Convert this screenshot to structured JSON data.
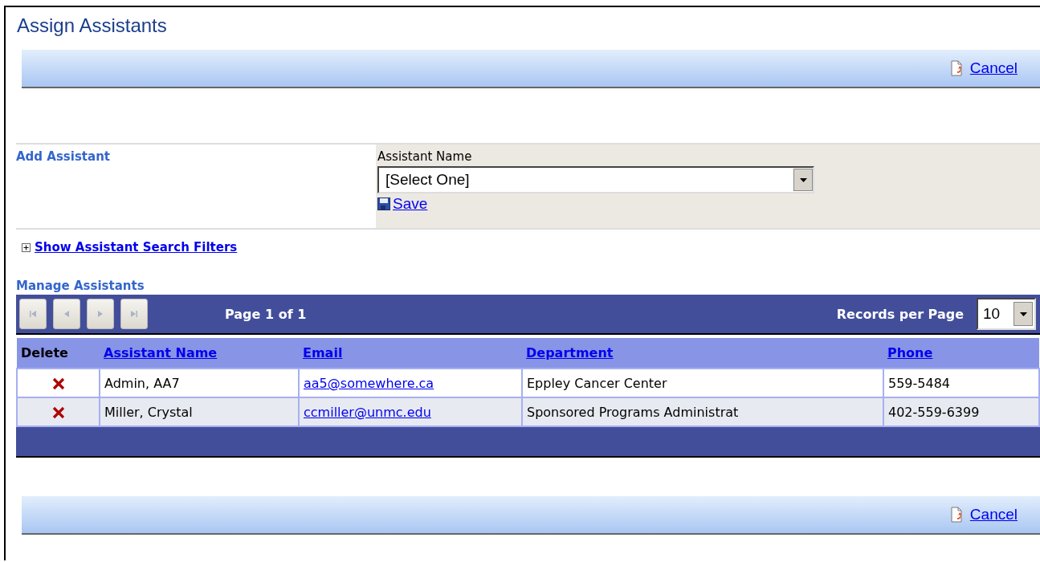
{
  "page_title": "Assign Assistants",
  "top_toolbar": {
    "cancel": "Cancel"
  },
  "add_assistant": {
    "heading": "Add Assistant",
    "field_label": "Assistant Name",
    "select_value": "[Select One]",
    "save": "Save"
  },
  "filters_link": {
    "label": "Show Assistant Search Filters",
    "expanded": false
  },
  "manage": {
    "heading": "Manage Assistants",
    "pager": {
      "page_text": "Page 1 of 1",
      "buttons": [
        {
          "kind": "first",
          "disabled": true
        },
        {
          "kind": "prev",
          "disabled": true
        },
        {
          "kind": "next",
          "disabled": true
        },
        {
          "kind": "last",
          "disabled": true
        }
      ],
      "records_label": "Records per Page",
      "records_value": "10"
    },
    "columns": [
      {
        "label": "Delete",
        "sortable": false
      },
      {
        "label": "Assistant Name",
        "sortable": true
      },
      {
        "label": "Email",
        "sortable": true
      },
      {
        "label": "Department",
        "sortable": true
      },
      {
        "label": "Phone",
        "sortable": true
      }
    ],
    "rows": [
      {
        "name": "Admin, AA7",
        "email": "aa5@somewhere.ca",
        "department": "Eppley Cancer Center",
        "phone": "559-5484"
      },
      {
        "name": "Miller, Crystal",
        "email": "ccmiller@unmc.edu",
        "department": "Sponsored Programs Administrat",
        "phone": "402-559-6399"
      }
    ]
  },
  "bottom_toolbar": {
    "cancel": "Cancel"
  }
}
